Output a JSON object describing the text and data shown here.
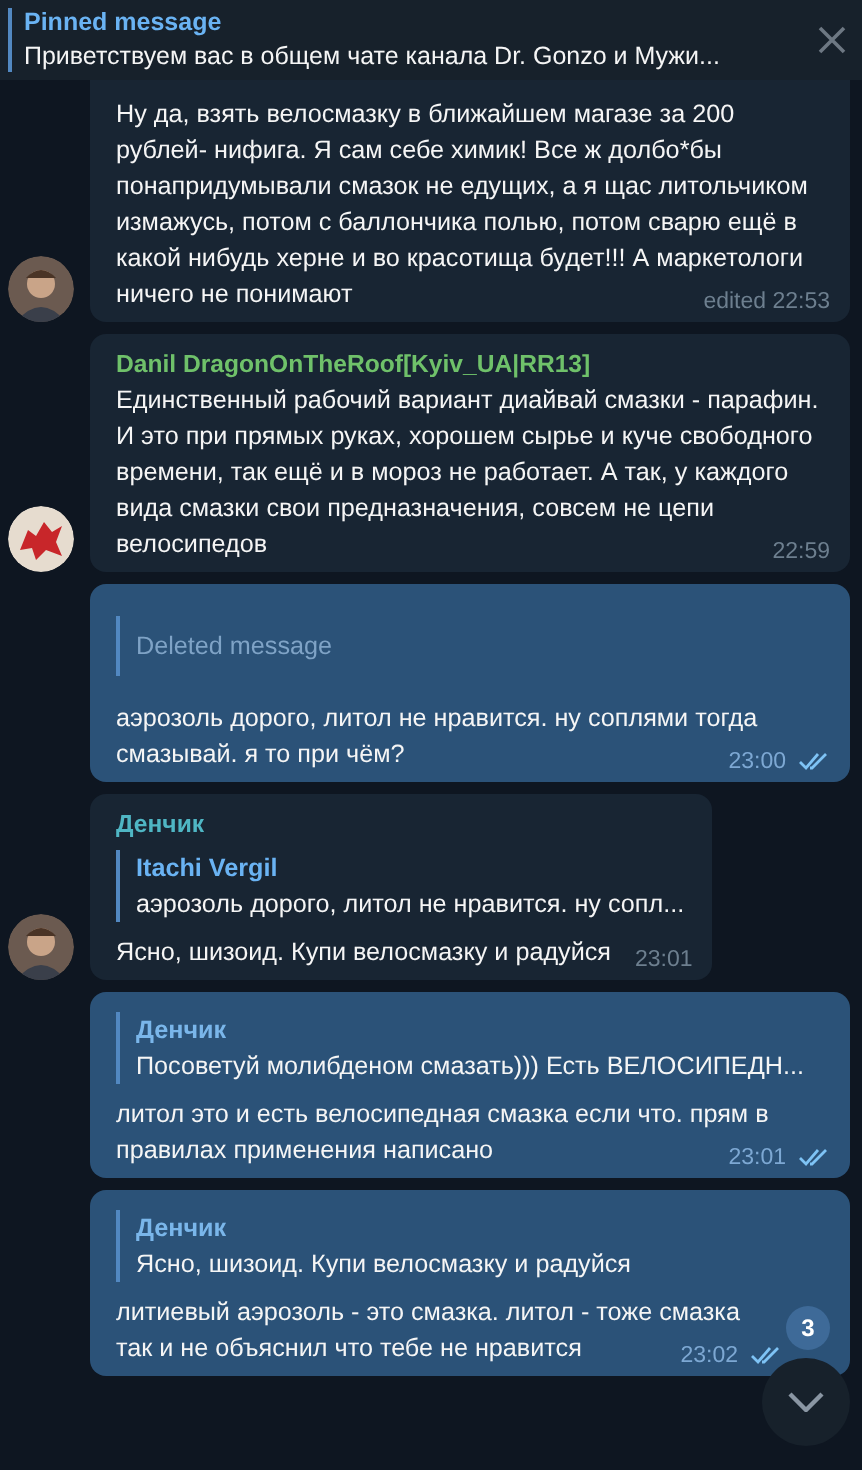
{
  "pinned": {
    "title": "Pinned message",
    "text": "Приветствуем вас в общем чате канала Dr. Gonzo и Мужи..."
  },
  "messages": [
    {
      "kind": "incoming",
      "text": "Ну да, взять велосмазку в ближайшем магазе за 200 рублей- нифига. Я сам себе химик! Все ж долбо*бы понапридумывали смазок не едущих, а я щас литольчиком измажусь, потом с баллончика полью, потом сварю ещё в какой нибудь херне и во красотища будет!!! А маркетологи ничего не понимают",
      "time": "edited 22:53",
      "avatar": {
        "kind": "person"
      }
    },
    {
      "kind": "incoming",
      "author": "Danil DragonOnTheRoof[Kyiv_UA|RR13]",
      "color": "#6fc16a",
      "text": "Единственный рабочий вариант диайвай смазки - парафин. И это при прямых руках, хорошем сырье и куче свободного времени, так ещё и в мороз не работает. А так, у каждого вида смазки свои предназначения, совсем не цепи велосипедов",
      "time": "22:59",
      "avatar": {
        "kind": "dragon"
      }
    },
    {
      "kind": "outgoing",
      "reply": {
        "kind": "deleted",
        "text": "Deleted message"
      },
      "text": "аэрозоль дорого, литол не нравится. ну соплями тогда смазывай. я то при чём?",
      "time": "23:00",
      "read": true
    },
    {
      "kind": "incoming",
      "author": "Денчик",
      "color": "#4fb6c4",
      "reply": {
        "kind": "quote",
        "author": "Itachi Vergil",
        "text": "аэрозоль дорого, литол не нравится. ну сопл..."
      },
      "text": "Ясно, шизоид. Купи велосмазку и радуйся",
      "time": "23:01",
      "avatar": {
        "kind": "person"
      }
    },
    {
      "kind": "outgoing",
      "reply": {
        "kind": "quote",
        "author": "Денчик",
        "text": "Посоветуй молибденом смазать))) Есть ВЕЛОСИПЕДН..."
      },
      "text": "литол это и есть велосипедная смазка если что. прям в правилах применения написано",
      "time": "23:01",
      "read": true
    },
    {
      "kind": "outgoing",
      "reply": {
        "kind": "quote",
        "author": "Денчик",
        "text": "Ясно, шизоид. Купи велосмазку и радуйся"
      },
      "text": "литиевый аэрозоль - это смазка. литол - тоже смазка так и не объяснил что тебе не нравится",
      "time": "23:02",
      "read": true
    }
  ],
  "scroll_button": {
    "badge": "3"
  }
}
